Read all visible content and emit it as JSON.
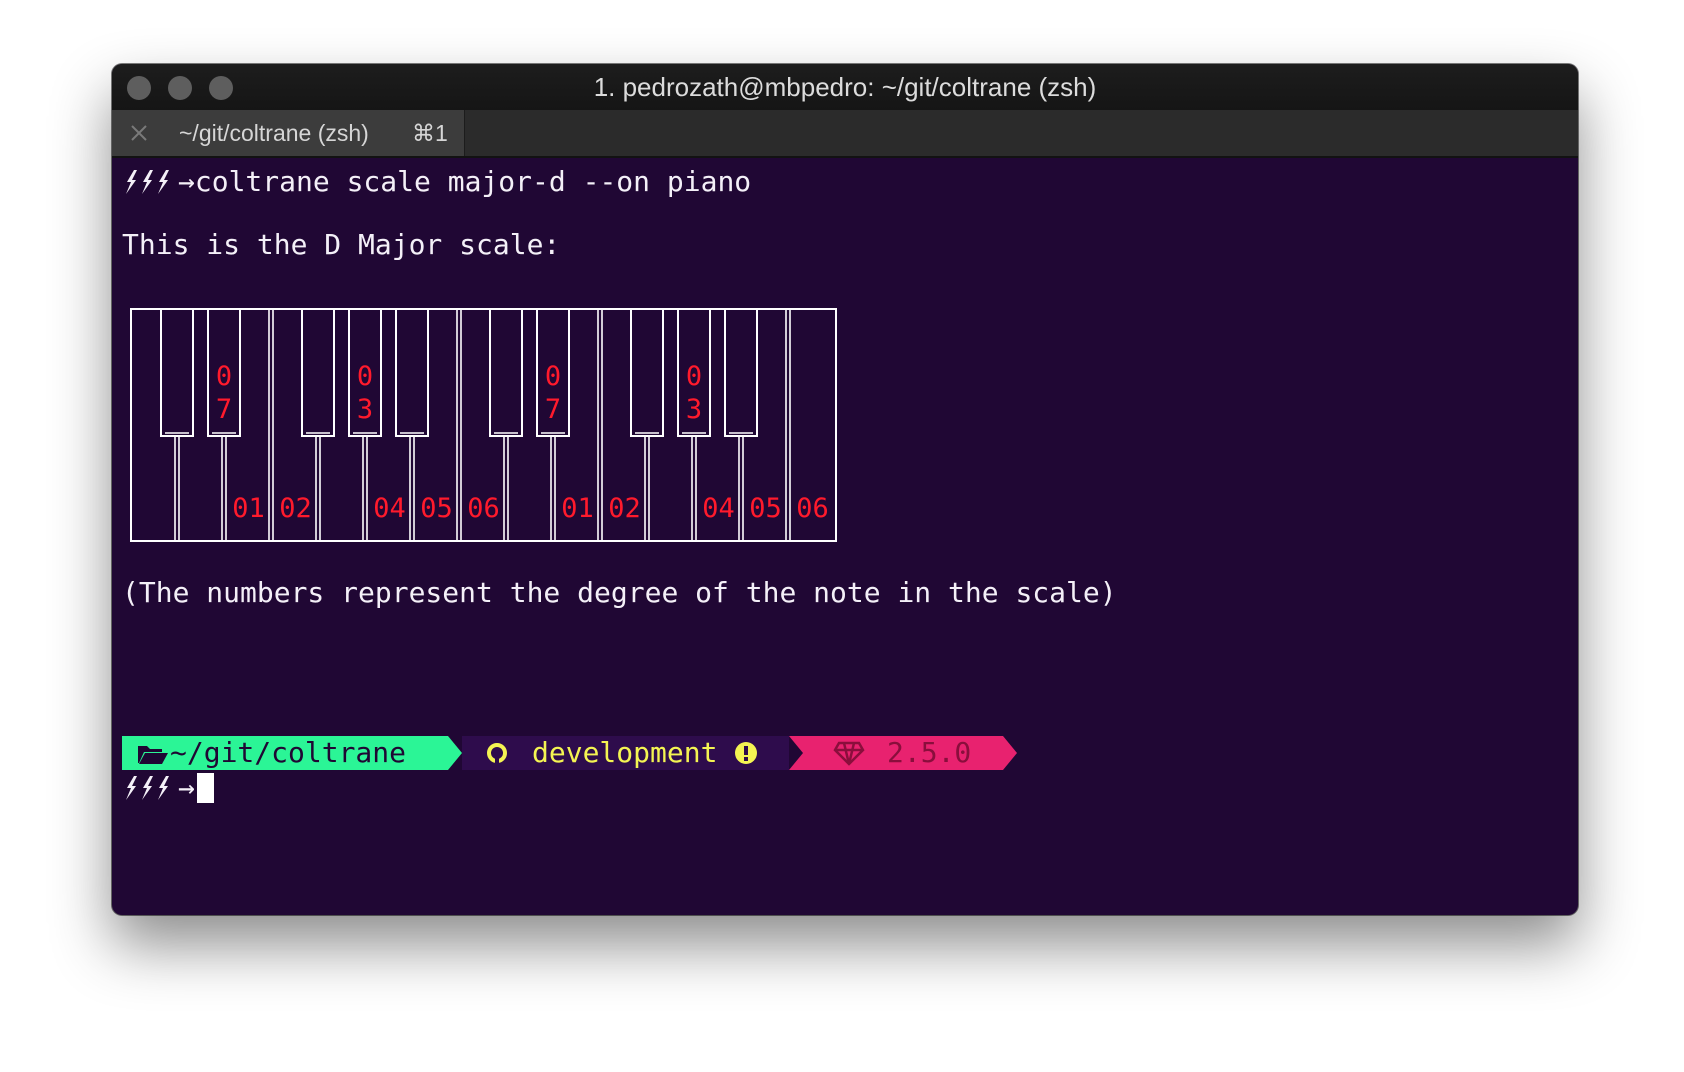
{
  "window": {
    "title": "1. pedrozath@mbpedro: ~/git/coltrane (zsh)",
    "tab": {
      "label": "~/git/coltrane (zsh)",
      "shortcut": "⌘1"
    }
  },
  "terminal": {
    "prompt_symbol": "→",
    "command": "coltrane scale major-d --on piano",
    "heading": "This is the D Major scale:",
    "footnote": "(The numbers represent the degree of the note in the scale)",
    "piano": {
      "black_labels": [
        {
          "key": 1,
          "top": "0",
          "bottom": "7"
        },
        {
          "key": 3,
          "top": "0",
          "bottom": "3"
        },
        {
          "key": 6,
          "top": "0",
          "bottom": "7"
        },
        {
          "key": 8,
          "top": "0",
          "bottom": "3"
        }
      ],
      "white_labels": [
        "",
        "",
        "01",
        "02",
        "",
        "04",
        "05",
        "06",
        "",
        "01",
        "02",
        "",
        "04",
        "05",
        "06"
      ]
    },
    "status": {
      "directory": "~/git/coltrane",
      "branch": "development",
      "ruby_version": "2.5.0"
    },
    "colors": {
      "background": "#200734",
      "dir_segment": "#2bf596",
      "git_segment": "#2e0c4c",
      "ruby_segment": "#e8226f",
      "note_labels": "#ff1a2c"
    }
  }
}
